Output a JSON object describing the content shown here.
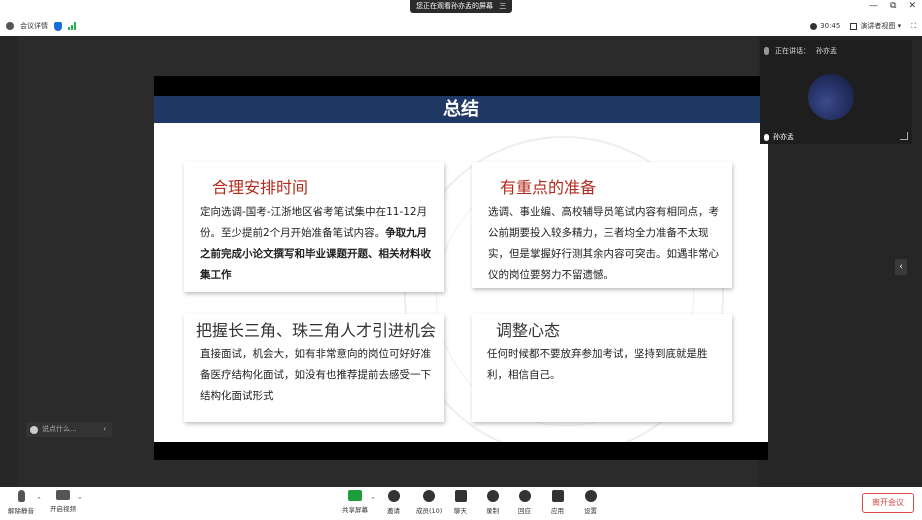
{
  "titlebar": {
    "share_notice": "您正在观看孙亦孟的屏幕",
    "dropdown_glyph": "三",
    "window_controls": [
      "—",
      "⧉",
      "✕"
    ]
  },
  "topbar": {
    "meeting_info": "会议详情",
    "timer": "30:45",
    "view_mode": "演讲者视图 ▾",
    "fullscreen_glyph": "⛶"
  },
  "slide": {
    "title": "总结",
    "cards": [
      {
        "heading": "合理安排时间",
        "text_normal": "定向选调-国考-江浙地区省考笔试集中在11-12月份。至少提前2个月开始准备笔试内容。",
        "text_bold": "争取九月之前完成小论文撰写和毕业课题开题、相关材料收集工作"
      },
      {
        "heading": "有重点的准备",
        "text": "选调、事业编、高校辅导员笔试内容有相同点，考公前期要投入较多精力，三者均全力准备不太现实，但是掌握好行测其余内容可突击。如遇非常心仪的岗位要努力不留遗憾。"
      },
      {
        "heading": "把握长三角、珠三角人才引进机会",
        "text": "直接面试，机会大，如有非常意向的岗位可好好准备医疗结构化面试，如没有也推荐提前去感受一下结构化面试形式"
      },
      {
        "heading": "调整心态",
        "text": "任何时候都不要放弃参加考试，坚持到底就是胜利，相信自己。"
      }
    ]
  },
  "video": {
    "speaking_label": "正在讲话：",
    "speaker": "孙亦孟",
    "name_tag": "孙亦孟"
  },
  "chat": {
    "placeholder": "说点什么...",
    "collapse_glyph": "‹"
  },
  "side_collapse_glyph": "‹",
  "toolbar": {
    "items": [
      "解除静音",
      "开启视频",
      "共享屏幕",
      "邀请",
      "成员(10)",
      "聊天",
      "录制",
      "回应",
      "应用",
      "设置"
    ],
    "end_meeting": "离开会议"
  },
  "colors": {
    "banner": "#1f3864",
    "card_heading_red": "#b52a1c",
    "share_green": "#1d9e3a",
    "end_red": "#d94a4a"
  }
}
